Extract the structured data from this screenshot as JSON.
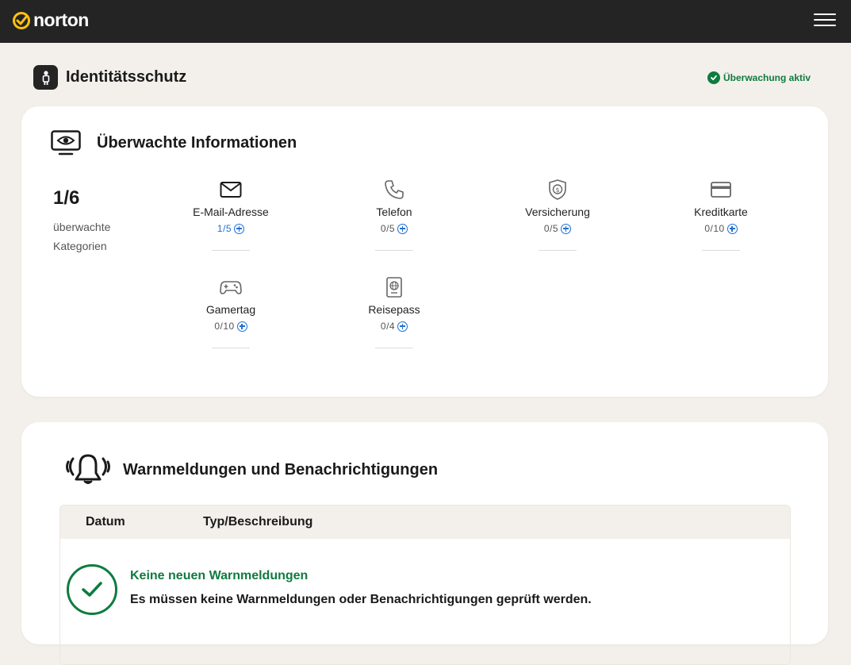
{
  "header": {
    "logo_text": "norton",
    "menu_icon": "hamburger-icon"
  },
  "page": {
    "title": "Identitätsschutz",
    "status": "Überwachung aktiv",
    "status_color": "#0f7b3f"
  },
  "monitored": {
    "title": "Überwachte Informationen",
    "count": "1/6",
    "count_label": "überwachte Kategorien",
    "categories": [
      {
        "label": "E-Mail-Adresse",
        "count": "1/5",
        "icon": "envelope-icon"
      },
      {
        "label": "Telefon",
        "count": "0/5",
        "icon": "phone-icon"
      },
      {
        "label": "Versicherung",
        "count": "0/5",
        "icon": "shield-dollar-icon"
      },
      {
        "label": "Kreditkarte",
        "count": "0/10",
        "icon": "credit-card-icon"
      },
      {
        "label": "Gamertag",
        "count": "0/10",
        "icon": "gamepad-icon"
      },
      {
        "label": "Reisepass",
        "count": "0/4",
        "icon": "passport-icon"
      }
    ]
  },
  "alerts": {
    "title": "Warnmeldungen und Benachrichtigungen",
    "columns": [
      "Datum",
      "Typ/Beschreibung"
    ],
    "empty_title": "Keine neuen Warnmeldungen",
    "empty_desc": "Es müssen keine Warnmeldungen oder Benachrichtigungen geprüft werden."
  },
  "colors": {
    "topbar": "#242424",
    "background": "#f3f0eb",
    "accent_blue": "#1f6fd0",
    "brand_yellow": "#ffc20e"
  }
}
